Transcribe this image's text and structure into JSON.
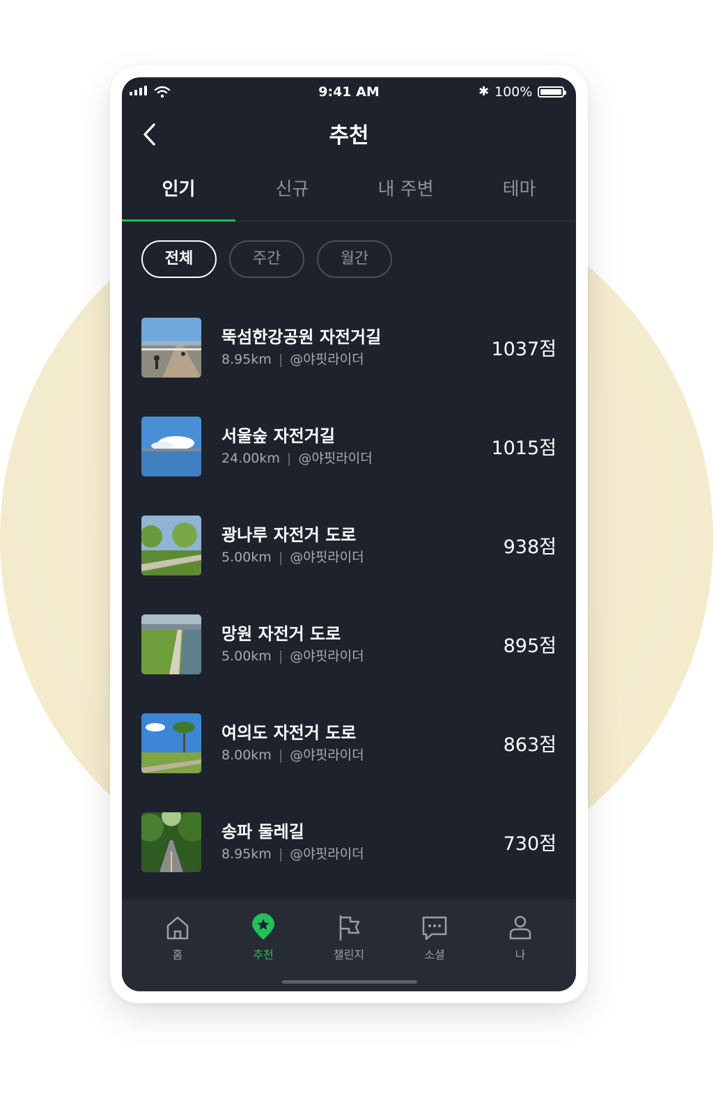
{
  "status": {
    "time": "9:41 AM",
    "battery": "100%"
  },
  "nav": {
    "title": "추천"
  },
  "tabs": [
    {
      "label": "인기",
      "active": true
    },
    {
      "label": "신규",
      "active": false
    },
    {
      "label": "내 주변",
      "active": false
    },
    {
      "label": "테마",
      "active": false
    }
  ],
  "filters": [
    {
      "label": "전체",
      "active": true
    },
    {
      "label": "주간",
      "active": false
    },
    {
      "label": "월간",
      "active": false
    }
  ],
  "routes": [
    {
      "name": "뚝섬한강공원 자전거길",
      "distance": "8.95km",
      "author": "@야핏라이더",
      "score": "1037점"
    },
    {
      "name": "서울숲 자전거길",
      "distance": "24.00km",
      "author": "@야핏라이더",
      "score": "1015점"
    },
    {
      "name": "광나루 자전거 도로",
      "distance": "5.00km",
      "author": "@야핏라이더",
      "score": "938점"
    },
    {
      "name": "망원 자전거 도로",
      "distance": "5.00km",
      "author": "@야핏라이더",
      "score": "895점"
    },
    {
      "name": "여의도 자전거 도로",
      "distance": "8.00km",
      "author": "@야핏라이더",
      "score": "863점"
    },
    {
      "name": "송파 둘레길",
      "distance": "8.95km",
      "author": "@야핏라이더",
      "score": "730점"
    }
  ],
  "bottom_nav": [
    {
      "label": "홈",
      "icon": "home-icon",
      "active": false
    },
    {
      "label": "추천",
      "icon": "star-pin-icon",
      "active": true
    },
    {
      "label": "챌린지",
      "icon": "flag-icon",
      "active": false
    },
    {
      "label": "소셜",
      "icon": "chat-icon",
      "active": false
    },
    {
      "label": "나",
      "icon": "user-icon",
      "active": false
    }
  ],
  "colors": {
    "accent": "#20c05a",
    "screen_bg": "#1e222c",
    "backdrop": "#f4ebcd"
  }
}
